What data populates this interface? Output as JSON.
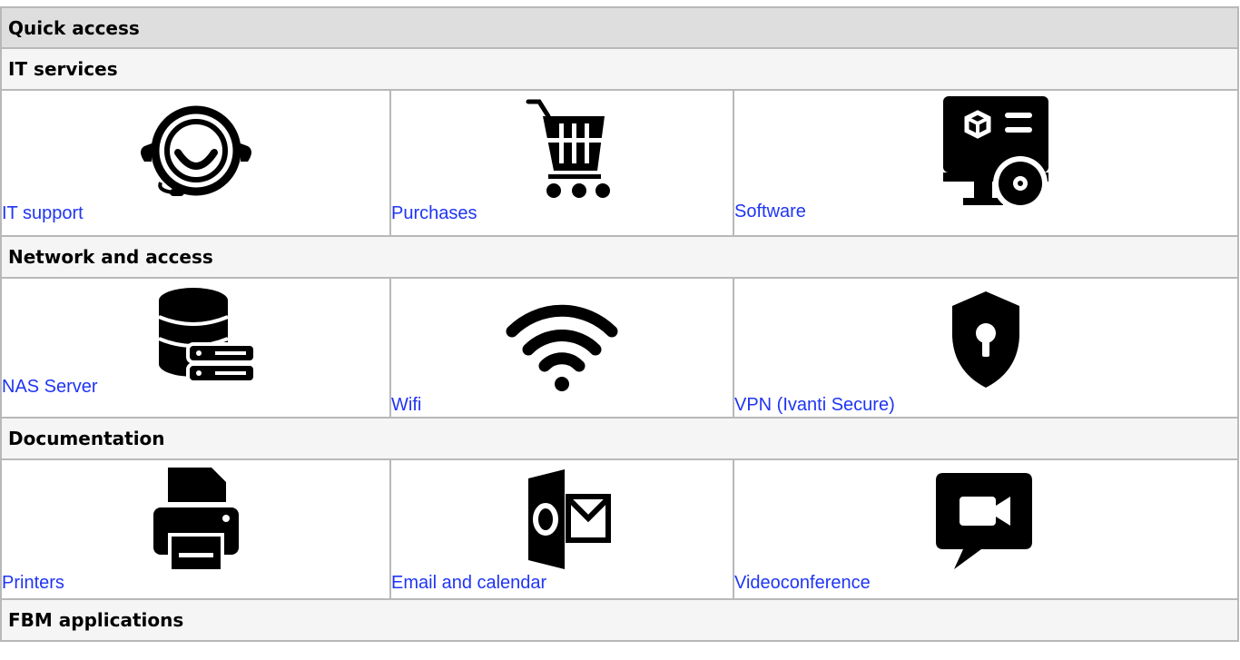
{
  "title": "Quick access",
  "colors": {
    "link": "#1f35f4",
    "icon": "#000000",
    "border": "#b8b8b8",
    "header_bg": "#dedede",
    "section_bg": "#f5f5f5"
  },
  "sections": [
    {
      "title": "IT services",
      "items": [
        {
          "label": "IT support",
          "icon": "headset-icon"
        },
        {
          "label": "Purchases",
          "icon": "cart-icon"
        },
        {
          "label": "Software",
          "icon": "software-install-icon"
        }
      ]
    },
    {
      "title": "Network and access",
      "items": [
        {
          "label": "NAS Server",
          "icon": "database-server-icon"
        },
        {
          "label": "Wifi",
          "icon": "wifi-icon"
        },
        {
          "label": "VPN (Ivanti Secure)",
          "icon": "shield-lock-icon"
        }
      ]
    },
    {
      "title": "Documentation",
      "items": [
        {
          "label": "Printers",
          "icon": "printer-icon"
        },
        {
          "label": "Email and calendar",
          "icon": "outlook-mail-icon"
        },
        {
          "label": "Videoconference",
          "icon": "video-chat-icon"
        }
      ]
    },
    {
      "title": "FBM applications",
      "items": []
    }
  ]
}
